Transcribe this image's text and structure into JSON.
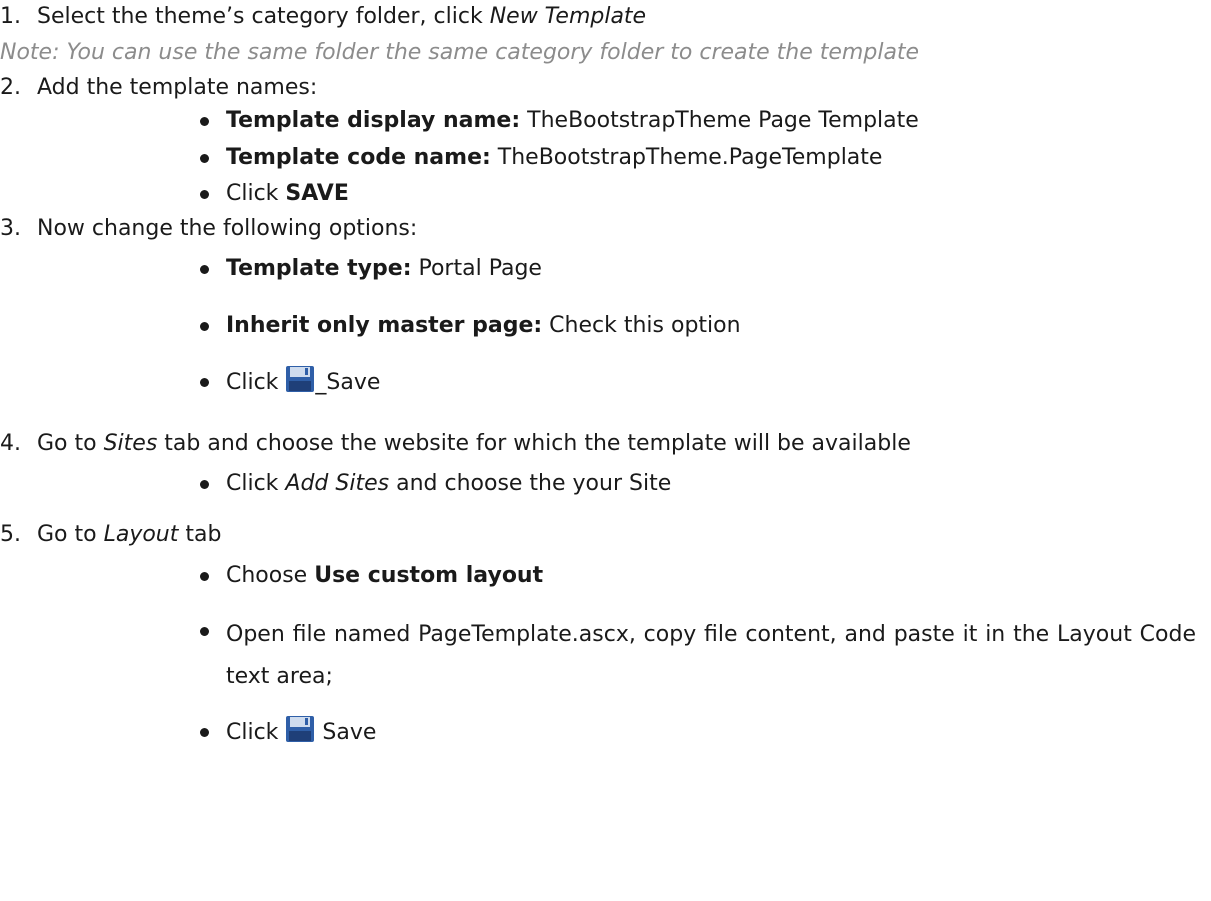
{
  "steps": {
    "s1": {
      "num": "1.",
      "text": "Select the theme’s category folder, click ",
      "em": "New Template"
    },
    "note": "Note: You can use the same folder the same category folder to create the template",
    "s2": {
      "num": "2.",
      "text": "Add the template names:",
      "b1": {
        "bold": "Template display name:",
        "text": " TheBootstrapTheme Page Template"
      },
      "b2": {
        "bold": "Template code name:",
        "text": " TheBootstrapTheme.PageTemplate"
      },
      "b3": {
        "pre": "Click ",
        "bold": "SAVE"
      }
    },
    "s3": {
      "num": "3.",
      "text": "Now change the following options:",
      "b1": {
        "bold": "Template type:",
        "text": " Portal Page"
      },
      "b2": {
        "bold": "Inherit only master page:",
        "text": " Check this option"
      },
      "b3": {
        "pre": "Click ",
        "post": "_Save",
        "icon": "floppy-disk-icon"
      }
    },
    "s4": {
      "num": "4.",
      "pre": "Go to ",
      "em": "Sites",
      "post": " tab and choose the website for which the template will be available",
      "b1": {
        "pre": "Click ",
        "em": "Add Sites",
        "post": " and choose the your Site"
      }
    },
    "s5": {
      "num": "5.",
      "pre": "Go to ",
      "em": "Layout",
      "post": " tab",
      "b1": {
        "pre": "Choose ",
        "bold": "Use custom layout"
      },
      "b2": {
        "text": "Open file named PageTemplate.ascx, copy file content, and paste it in the Layout Code text area;"
      },
      "b3": {
        "pre": "Click ",
        "post": " Save",
        "icon": "floppy-disk-icon"
      }
    }
  },
  "colors": {
    "text": "#1a1a1a",
    "note": "#8c8c8c",
    "icon_blue": "#2f5fa8",
    "icon_light": "#cfdcee"
  }
}
